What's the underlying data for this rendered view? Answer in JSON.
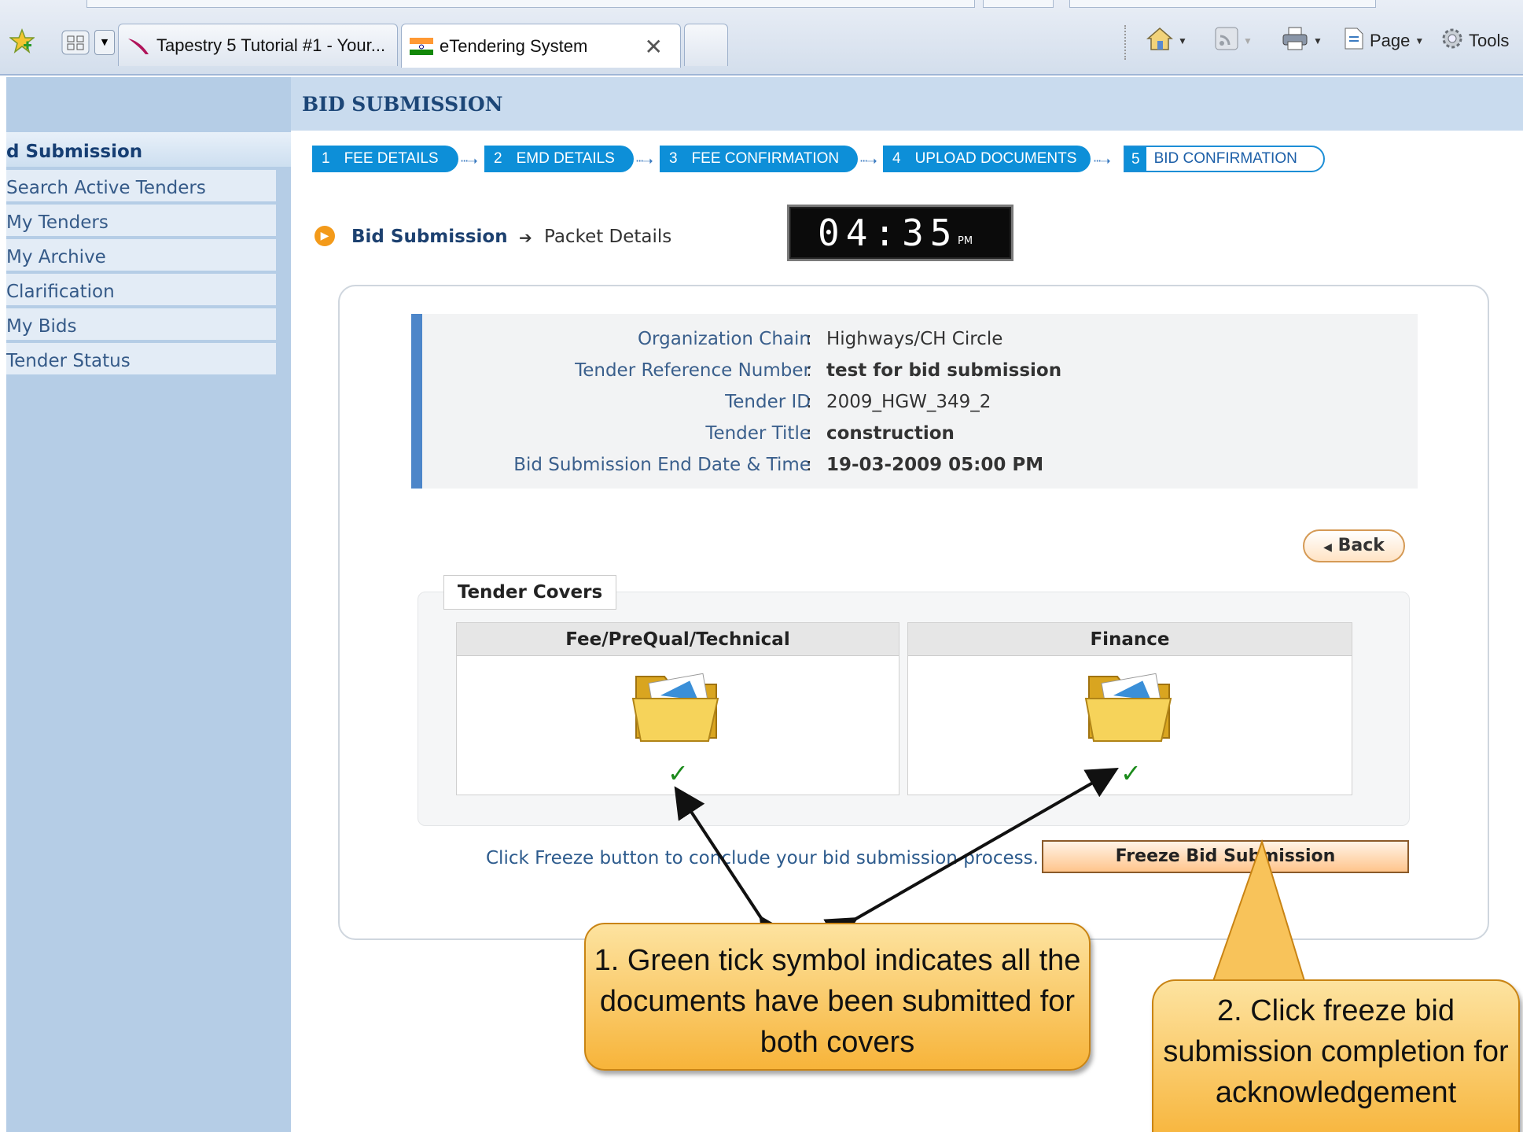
{
  "browser": {
    "tabs": [
      {
        "label": "Tapestry 5 Tutorial #1 - Your..."
      },
      {
        "label": "eTendering System",
        "close": "✕"
      }
    ],
    "toolbar": {
      "page_label": "Page",
      "tools_label": "Tools"
    }
  },
  "sidebar": {
    "header": "d Submission",
    "items": [
      {
        "label": "Search Active Tenders"
      },
      {
        "label": "My Tenders"
      },
      {
        "label": "My Archive"
      },
      {
        "label": "Clarification"
      },
      {
        "label": "My Bids"
      },
      {
        "label": "Tender Status"
      }
    ]
  },
  "page": {
    "title": "BID SUBMISSION",
    "steps": [
      {
        "num": "1",
        "label": "FEE DETAILS"
      },
      {
        "num": "2",
        "label": "EMD DETAILS"
      },
      {
        "num": "3",
        "label": "FEE CONFIRMATION"
      },
      {
        "num": "4",
        "label": "UPLOAD DOCUMENTS"
      },
      {
        "num": "5",
        "label": "BID CONFIRMATION"
      }
    ],
    "breadcrumb": {
      "current": "Bid Submission",
      "next": "Packet Details"
    },
    "clock": {
      "time": "04:35",
      "ampm": "PM"
    },
    "details": [
      {
        "label": "Organization Chain",
        "value": "Highways/CH Circle"
      },
      {
        "label": "Tender Reference Number",
        "value": "test for bid submission"
      },
      {
        "label": "Tender ID",
        "value": "2009_HGW_349_2"
      },
      {
        "label": "Tender Title",
        "value": "construction"
      },
      {
        "label": "Bid Submission End Date & Time",
        "value": "19-03-2009 05:00 PM"
      }
    ],
    "colon": ":",
    "back_label": "Back",
    "covers": {
      "legend": "Tender Covers",
      "items": [
        {
          "title": "Fee/PreQual/Technical",
          "status": "✓"
        },
        {
          "title": "Finance",
          "status": "✓"
        }
      ]
    },
    "freeze_message": "Click Freeze button to conclude your bid submission process.",
    "freeze_button": "Freeze Bid Submission"
  },
  "annotations": {
    "callout1": "1. Green tick symbol indicates all the documents have been submitted for both covers",
    "callout2": "2. Click freeze bid submission completion for acknowledgement"
  },
  "colors": {
    "accent_blue": "#0d8fd8",
    "sidebar_bg": "#b5cde6",
    "tick_green": "#1a8a1a",
    "callout_orange": "#f7b43a"
  },
  "icons": [
    "favorites-star-icon",
    "quick-tabs-icon",
    "tapestry-feather-icon",
    "india-flag-icon",
    "home-icon",
    "feeds-icon",
    "print-icon",
    "page-icon",
    "tools-gear-icon",
    "folder-icon",
    "checkmark-icon",
    "bullet-arrow-icon"
  ]
}
